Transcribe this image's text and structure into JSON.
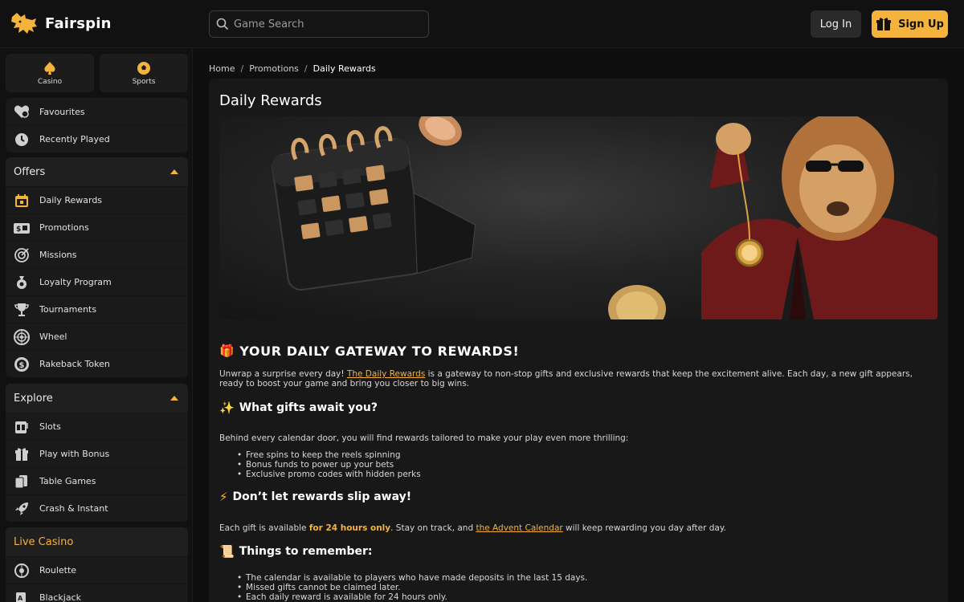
{
  "header": {
    "brand": "Fairspin",
    "search_placeholder": "Game Search",
    "login_label": "Log In",
    "signup_label": "Sign Up"
  },
  "sidebar": {
    "verticals": [
      {
        "label": "Casino",
        "icon": "spade-icon"
      },
      {
        "label": "Sports",
        "icon": "ball-icon"
      }
    ],
    "quick": [
      {
        "label": "Favourites",
        "icon": "heart-icon"
      },
      {
        "label": "Recently Played",
        "icon": "history-icon"
      }
    ],
    "offers": {
      "title": "Offers",
      "items": [
        {
          "label": "Daily Rewards",
          "icon": "calendar-gift-icon"
        },
        {
          "label": "Promotions",
          "icon": "promotions-icon"
        },
        {
          "label": "Missions",
          "icon": "target-icon"
        },
        {
          "label": "Loyalty Program",
          "icon": "loyalty-icon"
        },
        {
          "label": "Tournaments",
          "icon": "trophy-icon"
        },
        {
          "label": "Wheel",
          "icon": "wheel-icon"
        },
        {
          "label": "Rakeback Token",
          "icon": "token-icon"
        }
      ]
    },
    "explore": {
      "title": "Explore",
      "items": [
        {
          "label": "Slots",
          "icon": "slots-icon"
        },
        {
          "label": "Play with Bonus",
          "icon": "gift-icon"
        },
        {
          "label": "Table Games",
          "icon": "cards-icon"
        },
        {
          "label": "Crash & Instant",
          "icon": "rocket-icon"
        }
      ]
    },
    "live": {
      "title": "Live Casino",
      "items": [
        {
          "label": "Roulette",
          "icon": "roulette-icon"
        },
        {
          "label": "Blackjack",
          "icon": "blackjack-icon"
        }
      ]
    }
  },
  "breadcrumb": {
    "items": [
      "Home",
      "Promotions",
      "Daily Rewards"
    ],
    "separator": "/"
  },
  "main": {
    "title": "Daily Rewards",
    "gateway_heading": "YOUR DAILY GATEWAY TO REWARDS!",
    "intro_before": "Unwrap a surprise every day! ",
    "intro_link": "The Daily Rewards",
    "intro_after": " is a gateway to non-stop gifts and exclusive rewards that keep the excitement alive. Each day, a new gift appears, ready to boost your game and bring you closer to big wins.",
    "gifts_heading": "What gifts await you?",
    "gifts_intro": "Behind every calendar door, you will find rewards tailored to make your play even more thrilling:",
    "gifts_list": [
      "Free spins to keep the reels spinning",
      "Bonus funds to power up your bets",
      "Exclusive promo codes with hidden perks"
    ],
    "slip_heading": "Don’t let rewards slip away!",
    "slip_before": "Each gift is available ",
    "slip_strong": "for 24 hours only",
    "slip_middle": ". Stay on track, and ",
    "slip_link": "the Advent Calendar",
    "slip_after": " will keep rewarding you day after day.",
    "remember_heading": "Things to remember:",
    "remember_list": [
      "The calendar is available to players who have made deposits in the last 15 days.",
      "Missed gifts cannot be claimed later.",
      "Each daily reward is available for 24 hours only."
    ]
  },
  "colors": {
    "accent": "#f3b33d",
    "background": "#0f0f0f",
    "card": "#181818",
    "sidebar": "#111111"
  }
}
